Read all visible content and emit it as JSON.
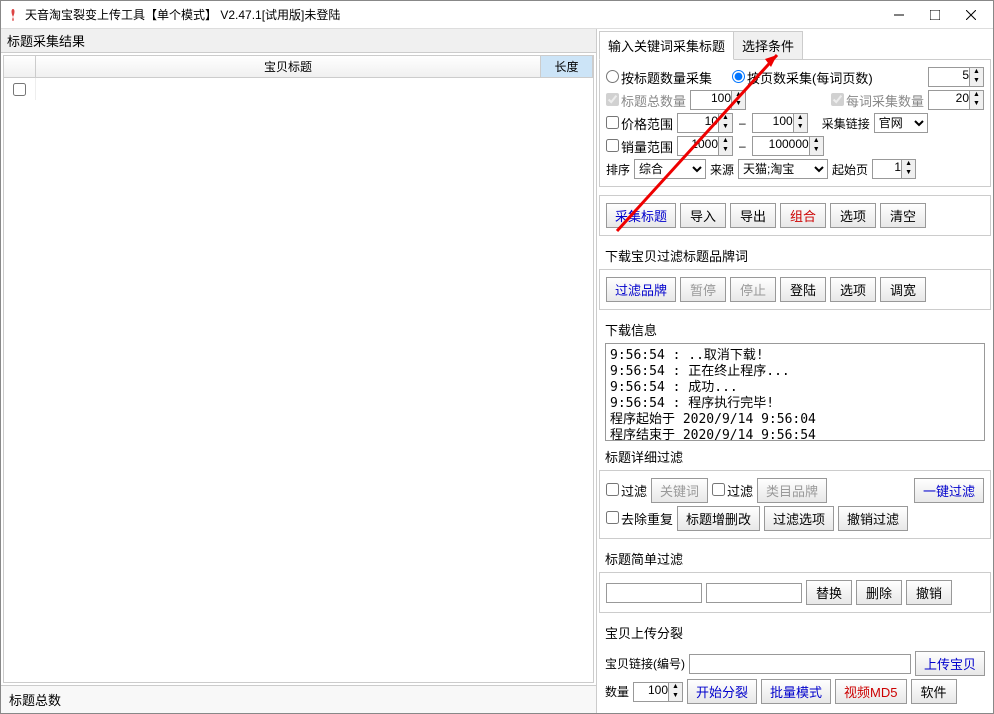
{
  "window": {
    "title": "天音淘宝裂变上传工具【单个模式】 V2.47.1[试用版]未登陆"
  },
  "left": {
    "header": "标题采集结果",
    "col_title": "宝贝标题",
    "col_len": "长度",
    "footer": "标题总数"
  },
  "tabs": {
    "tab1": "输入关键词采集标题",
    "tab2": "选择条件"
  },
  "collect": {
    "by_qty": "按标题数量采集",
    "by_page": "按页数采集(每词页数)",
    "page_val": "5",
    "total_title": "标题总数量",
    "total_title_val": "100",
    "per_word": "每词采集数量",
    "per_word_val": "20",
    "price_range": "价格范围",
    "price_min": "10",
    "price_max": "100",
    "collect_link": "采集链接",
    "link_val": "官网",
    "sales_range": "销量范围",
    "sales_min": "1000",
    "sales_max": "100000",
    "sort": "排序",
    "sort_val": "综合",
    "source": "来源",
    "source_val": "天猫;淘宝",
    "start_page": "起始页",
    "start_page_val": "1"
  },
  "btns1": {
    "collect": "采集标题",
    "import": "导入",
    "export": "导出",
    "combine": "组合",
    "options": "选项",
    "clear": "清空"
  },
  "filter_brand": {
    "header": "下载宝贝过滤标题品牌词",
    "filter": "过滤品牌",
    "pause": "暂停",
    "stop": "停止",
    "login": "登陆",
    "options": "选项",
    "widen": "调宽"
  },
  "download": {
    "header": "下载信息",
    "log": "9:56:54 : ..取消下载!\n9:56:54 : 正在终止程序...\n9:56:54 : 成功...\n9:56:54 : 程序执行完毕!\n程序起始于 2020/9/14 9:56:04\n程序结束于 2020/9/14 9:56:54"
  },
  "detail_filter": {
    "header": "标题详细过滤",
    "filter1": "过滤",
    "keyword": "关键词",
    "filter2": "过滤",
    "category": "类目品牌",
    "one_click": "一键过滤",
    "dedup": "去除重复",
    "edit": "标题增删改",
    "filter_opt": "过滤选项",
    "undo": "撤销过滤"
  },
  "simple_filter": {
    "header": "标题简单过滤",
    "replace": "替换",
    "delete": "删除",
    "undo": "撤销"
  },
  "upload": {
    "header": "宝贝上传分裂",
    "link_label": "宝贝链接(编号)",
    "upload_btn": "上传宝贝",
    "qty": "数量",
    "qty_val": "100",
    "start": "开始分裂",
    "batch": "批量模式",
    "video": "视频MD5",
    "soft": "软件"
  }
}
